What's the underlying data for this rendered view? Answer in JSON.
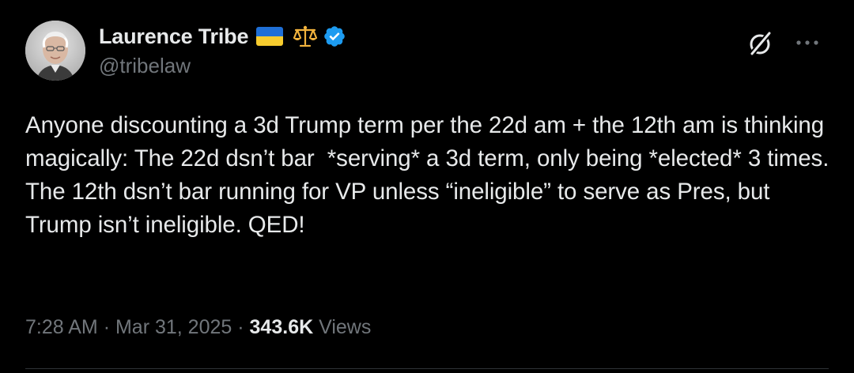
{
  "author": {
    "display_name": "Laurence Tribe",
    "handle": "@tribelaw",
    "badges": [
      "ukraine-flag-icon",
      "scales-of-justice-icon",
      "verified-badge-icon"
    ],
    "verified_color": "#1d9bf0"
  },
  "header_actions": {
    "grok_icon": "grok-icon",
    "more_icon": "more-options-icon"
  },
  "tweet": {
    "text": "Anyone discounting a 3d Trump term per the 22d am + the 12th am is thinking magically: The 22d dsn’t bar  *serving* a 3d term, only being *elected* 3 times. The 12th dsn’t bar running for VP unless “ineligible” to serve as Pres, but Trump isn’t ineligible. QED!"
  },
  "meta": {
    "time": "7:28 AM",
    "separator": "·",
    "date": "Mar 31, 2025",
    "views_count": "343.6K",
    "views_label": "Views"
  },
  "colors": {
    "background": "#000000",
    "primary_text": "#e7e9ea",
    "secondary_text": "#71767b",
    "divider": "#2f3336"
  }
}
